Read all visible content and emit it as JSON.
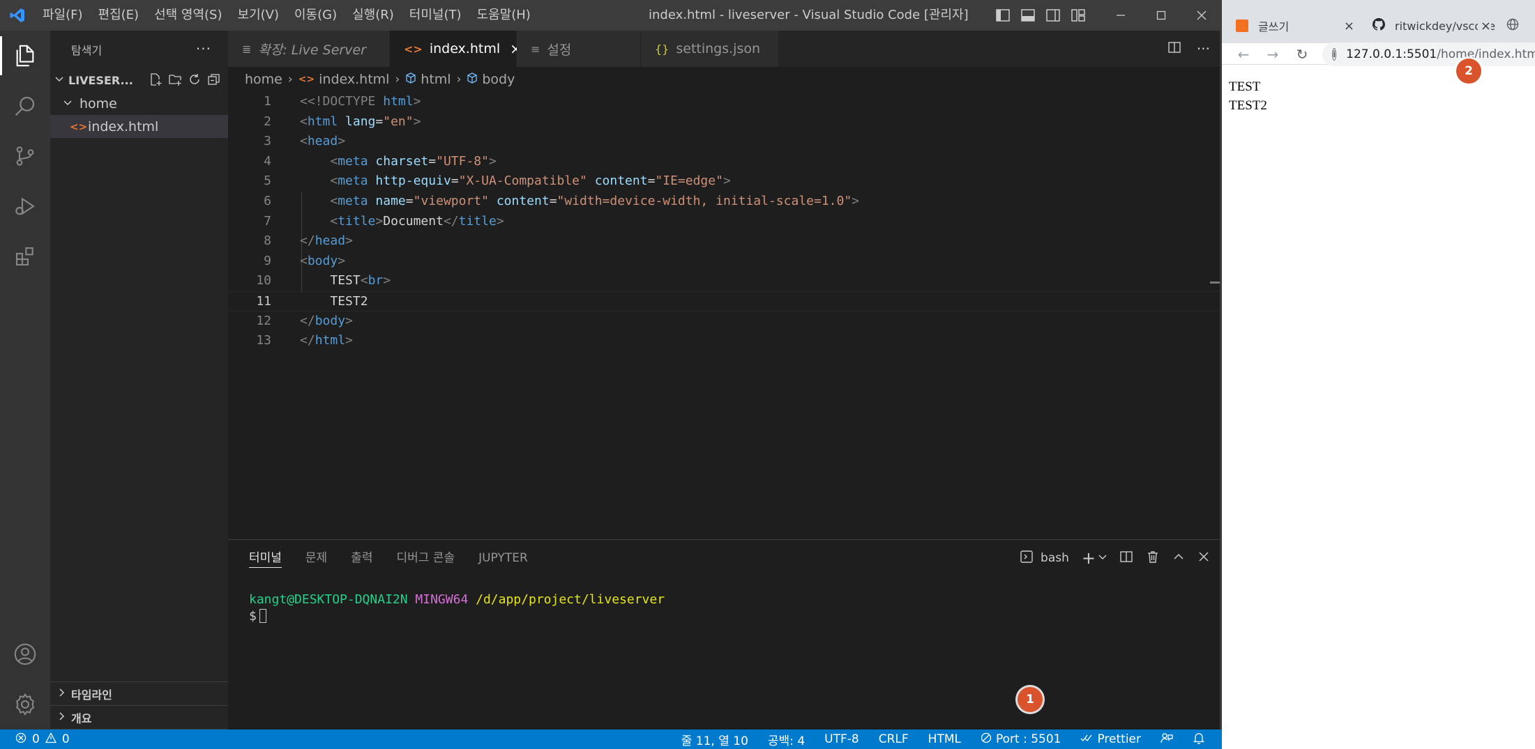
{
  "titlebar": {
    "menu": [
      "파일(F)",
      "편집(E)",
      "선택 영역(S)",
      "보기(V)",
      "이동(G)",
      "실행(R)",
      "터미널(T)",
      "도움말(H)"
    ],
    "title": "index.html - liveserver - Visual Studio Code [관리자]"
  },
  "sidebar": {
    "header": "탐색기",
    "more": "···",
    "folder": "LIVESER...",
    "tree": [
      {
        "label": "home",
        "type": "folder"
      },
      {
        "label": "index.html",
        "type": "file"
      }
    ],
    "footer": [
      "타임라인",
      "개요"
    ]
  },
  "tabs": [
    {
      "label": "확장: Live Server",
      "icon": "preview-icon"
    },
    {
      "label": "index.html",
      "icon": "html-file-icon",
      "active": true
    },
    {
      "label": "설정",
      "icon": "settings-lines-icon"
    },
    {
      "label": "settings.json",
      "icon": "json-braces-icon"
    }
  ],
  "breadcrumb": [
    "home",
    "index.html",
    "html",
    "body"
  ],
  "code": {
    "current_line": 11,
    "lines": [
      "1",
      "2",
      "3",
      "4",
      "5",
      "6",
      "7",
      "8",
      "9",
      "10",
      "11",
      "12",
      "13"
    ],
    "tokens": {
      "doctype": "<!DOCTYPE",
      "doctype_html": "html",
      "html_open": "html",
      "lang_attr": "lang",
      "lang_val": "\"en\"",
      "head": "head",
      "meta": "meta",
      "charset_attr": "charset",
      "charset_val": "\"UTF-8\"",
      "httpequiv_attr": "http-equiv",
      "httpequiv_val": "\"X-UA-Compatible\"",
      "content_attr": "content",
      "content_val_ie": "\"IE=edge\"",
      "name_attr": "name",
      "name_val": "\"viewport\"",
      "content_val_vp": "\"width=device-width, initial-scale=1.0\"",
      "title": "title",
      "title_text": "Document",
      "body": "body",
      "test1": "TEST",
      "br": "br",
      "test2": "TEST2"
    }
  },
  "panel": {
    "tabs": [
      "터미널",
      "문제",
      "출력",
      "디버그 콘솔",
      "JUPYTER"
    ],
    "shell": "bash",
    "prompt_user": "kangt@DESKTOP-DQNAI2N",
    "prompt_env": "MINGW64",
    "prompt_path": "/d/app/project/liveserver",
    "prompt_symbol": "$"
  },
  "statusbar": {
    "errors": "0",
    "warnings": "0",
    "position": "줄 11, 열 10",
    "spaces": "공백: 4",
    "encoding": "UTF-8",
    "eol": "CRLF",
    "language": "HTML",
    "port": "Port : 5501",
    "prettier": "Prettier"
  },
  "badges": [
    "1",
    "2"
  ],
  "browser": {
    "tabs": [
      {
        "label": "글쓰기"
      },
      {
        "label": "ritwickdey/vscode"
      }
    ],
    "url_host": "127.0.0.1:5501",
    "url_path": "/home/index.html",
    "page_lines": [
      "TEST",
      "TEST2"
    ]
  },
  "colors": {
    "statusbar": "#007acc",
    "badge": "#d9532c",
    "tag": "#569cd6",
    "attribute": "#9cdcfe",
    "string": "#ce9178"
  }
}
